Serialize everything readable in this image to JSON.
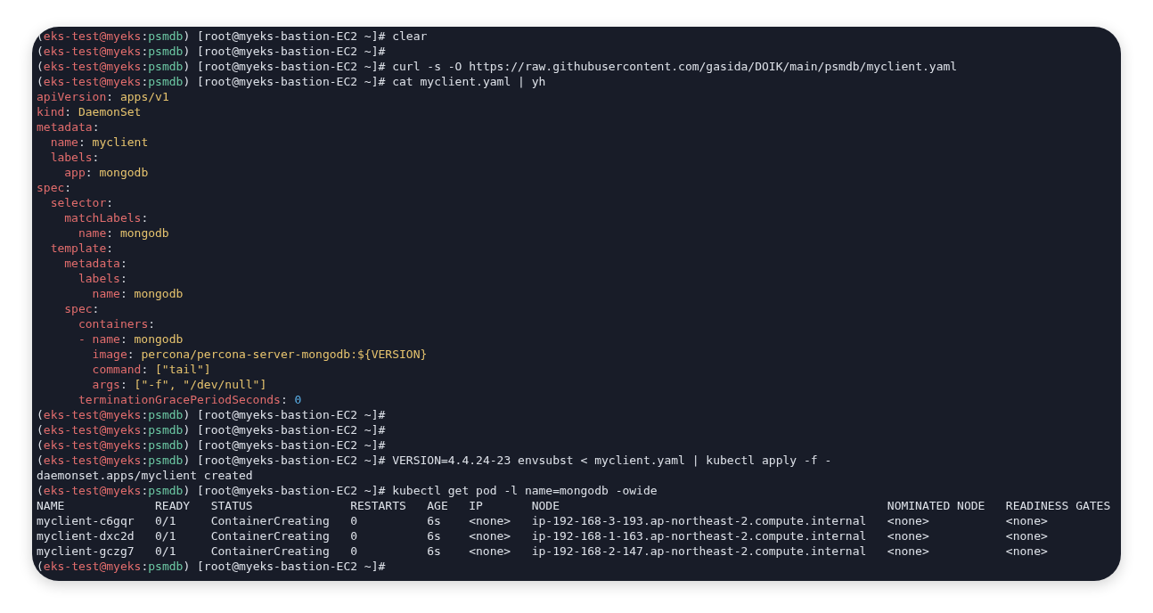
{
  "terminal": {
    "blocks": [
      {
        "kind": "prompt",
        "open": "(",
        "user": "eks-test@myeks",
        "colon": ":",
        "context": "psmdb",
        "close": ")",
        "shell": "[root@myeks-bastion-EC2 ~]#",
        "command": "clear"
      },
      {
        "kind": "prompt",
        "open": "(",
        "user": "eks-test@myeks",
        "colon": ":",
        "context": "psmdb",
        "close": ")",
        "shell": "[root@myeks-bastion-EC2 ~]#"
      },
      {
        "kind": "prompt",
        "open": "(",
        "user": "eks-test@myeks",
        "colon": ":",
        "context": "psmdb",
        "close": ")",
        "shell": "[root@myeks-bastion-EC2 ~]#",
        "command": "curl -s -O https://raw.githubusercontent.com/gasida/DOIK/main/psmdb/myclient.yaml"
      },
      {
        "kind": "prompt",
        "open": "(",
        "user": "eks-test@myeks",
        "colon": ":",
        "context": "psmdb",
        "close": ")",
        "shell": "[root@myeks-bastion-EC2 ~]#",
        "command": "cat myclient.yaml | yh"
      },
      {
        "kind": "yaml",
        "items": [
          {
            "key": "apiVersion",
            "colon": ":",
            "value": "apps/v1",
            "kind": "string"
          },
          {
            "key": "kind",
            "colon": ":",
            "value": "DaemonSet",
            "kind": "string"
          },
          {
            "key": "metadata",
            "colon": ":",
            "children": [
              {
                "key": "name",
                "colon": ":",
                "value": "myclient",
                "kind": "string"
              },
              {
                "key": "labels",
                "colon": ":",
                "children": [
                  {
                    "key": "app",
                    "colon": ":",
                    "value": "mongodb",
                    "kind": "string"
                  }
                ]
              }
            ]
          },
          {
            "key": "spec",
            "colon": ":",
            "children": [
              {
                "key": "selector",
                "colon": ":",
                "children": [
                  {
                    "key": "matchLabels",
                    "colon": ":",
                    "children": [
                      {
                        "key": "name",
                        "colon": ":",
                        "value": "mongodb",
                        "kind": "string"
                      }
                    ]
                  }
                ]
              },
              {
                "key": "template",
                "colon": ":",
                "children": [
                  {
                    "key": "metadata",
                    "colon": ":",
                    "children": [
                      {
                        "key": "labels",
                        "colon": ":",
                        "children": [
                          {
                            "key": "name",
                            "colon": ":",
                            "value": "mongodb",
                            "kind": "string"
                          }
                        ]
                      }
                    ]
                  },
                  {
                    "key": "spec",
                    "colon": ":",
                    "children": [
                      {
                        "key": "containers",
                        "colon": ":",
                        "list": [
                          {
                            "marker": "-",
                            "fields": [
                              {
                                "key": "name",
                                "colon": ":",
                                "value": "mongodb",
                                "kind": "string"
                              },
                              {
                                "key": "image",
                                "colon": ":",
                                "value": "percona/percona-server-mongodb:${VERSION}",
                                "kind": "string"
                              },
                              {
                                "key": "command",
                                "colon": ":",
                                "value": "[\"tail\"]",
                                "kind": "string"
                              },
                              {
                                "key": "args",
                                "colon": ":",
                                "value": "[\"-f\", \"/dev/null\"]",
                                "kind": "string"
                              }
                            ]
                          }
                        ]
                      },
                      {
                        "key": "terminationGracePeriodSeconds",
                        "colon": ":",
                        "value": "0",
                        "kind": "number"
                      }
                    ]
                  }
                ]
              }
            ]
          }
        ]
      },
      {
        "kind": "prompt",
        "open": "(",
        "user": "eks-test@myeks",
        "colon": ":",
        "context": "psmdb",
        "close": ")",
        "shell": "[root@myeks-bastion-EC2 ~]#"
      },
      {
        "kind": "prompt",
        "open": "(",
        "user": "eks-test@myeks",
        "colon": ":",
        "context": "psmdb",
        "close": ")",
        "shell": "[root@myeks-bastion-EC2 ~]#"
      },
      {
        "kind": "prompt",
        "open": "(",
        "user": "eks-test@myeks",
        "colon": ":",
        "context": "psmdb",
        "close": ")",
        "shell": "[root@myeks-bastion-EC2 ~]#"
      },
      {
        "kind": "prompt",
        "open": "(",
        "user": "eks-test@myeks",
        "colon": ":",
        "context": "psmdb",
        "close": ")",
        "shell": "[root@myeks-bastion-EC2 ~]#",
        "command": "VERSION=4.4.24-23 envsubst < myclient.yaml | kubectl apply -f -"
      },
      {
        "kind": "output",
        "text": "daemonset.apps/myclient created"
      },
      {
        "kind": "prompt",
        "open": "(",
        "user": "eks-test@myeks",
        "colon": ":",
        "context": "psmdb",
        "close": ")",
        "shell": "[root@myeks-bastion-EC2 ~]#",
        "command": "kubectl get pod -l name=mongodb -owide"
      },
      {
        "kind": "table",
        "columns": [
          "NAME",
          "READY",
          "STATUS",
          "RESTARTS",
          "AGE",
          "IP",
          "NODE",
          "NOMINATED NODE",
          "READINESS GATES"
        ],
        "rows": [
          [
            "myclient-c6gqr",
            "0/1",
            "ContainerCreating",
            "0",
            "6s",
            "<none>",
            "ip-192-168-3-193.ap-northeast-2.compute.internal",
            "<none>",
            "<none>"
          ],
          [
            "myclient-dxc2d",
            "0/1",
            "ContainerCreating",
            "0",
            "6s",
            "<none>",
            "ip-192-168-1-163.ap-northeast-2.compute.internal",
            "<none>",
            "<none>"
          ],
          [
            "myclient-gczg7",
            "0/1",
            "ContainerCreating",
            "0",
            "6s",
            "<none>",
            "ip-192-168-2-147.ap-northeast-2.compute.internal",
            "<none>",
            "<none>"
          ]
        ]
      },
      {
        "kind": "prompt",
        "open": "(",
        "user": "eks-test@myeks",
        "colon": ":",
        "context": "psmdb",
        "close": ")",
        "shell": "[root@myeks-bastion-EC2 ~]#"
      }
    ]
  }
}
